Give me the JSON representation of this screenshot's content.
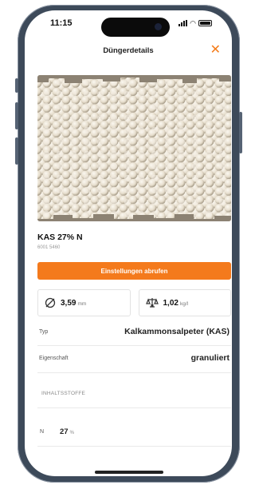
{
  "status_bar": {
    "time": "11:15"
  },
  "header": {
    "title": "Düngerdetails",
    "close_icon": "close-icon"
  },
  "product": {
    "name": "KAS 27% N",
    "subtitle": "6001 5460",
    "image": "fertilizer-granules-photo"
  },
  "action": {
    "label": "Einstellungen abrufen"
  },
  "stats": [
    {
      "icon": "diameter-icon",
      "value": "3,59",
      "unit": "mm"
    },
    {
      "icon": "weight-icon",
      "value": "1,02",
      "unit": "kg/l"
    }
  ],
  "details": [
    {
      "label": "Typ",
      "value": "Kalkammonsalpeter (KAS)"
    },
    {
      "label": "Eigenschaft",
      "value": "granuliert"
    }
  ],
  "ingredients": {
    "section_label": "INHALTSSTOFFE",
    "items": [
      {
        "label": "N",
        "value": "27",
        "unit": "%"
      }
    ]
  },
  "colors": {
    "accent": "#f47a1c",
    "frame": "#3d4a5a"
  }
}
